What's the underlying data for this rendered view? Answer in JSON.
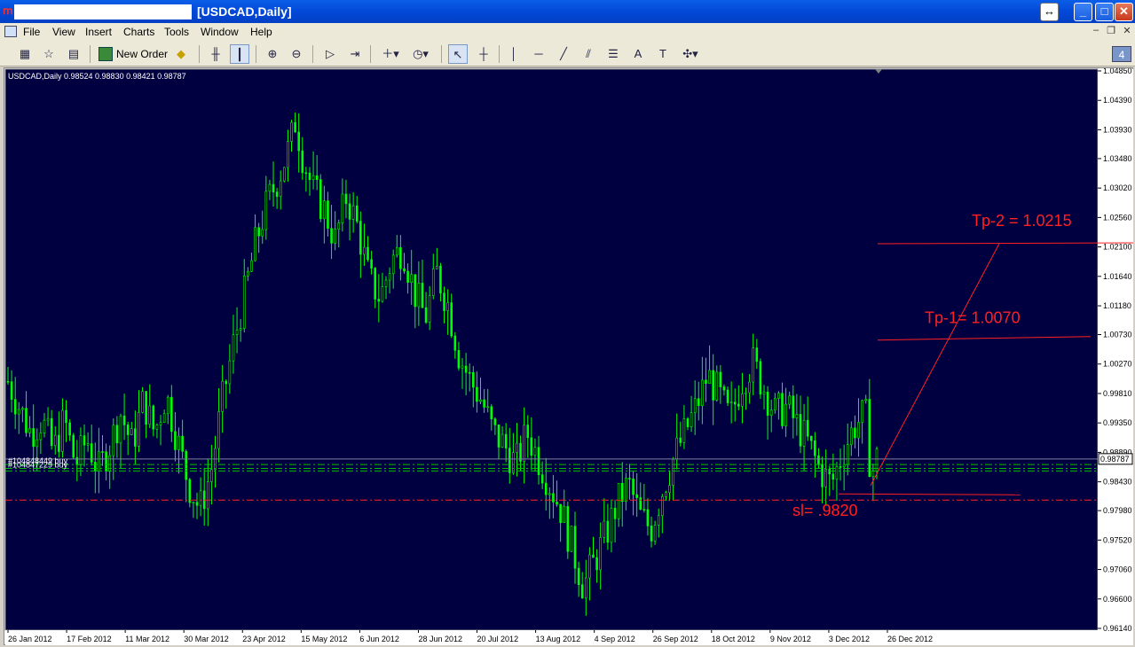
{
  "window": {
    "title": "[USDCAD,Daily]",
    "min_icon": "minimize-icon",
    "max_icon": "maximize-icon",
    "close_icon": "close-icon"
  },
  "menu": [
    "File",
    "View",
    "Insert",
    "Charts",
    "Tools",
    "Window",
    "Help"
  ],
  "toolbar": {
    "new_order": "New Order",
    "badge": "4"
  },
  "colors": {
    "chart_bg": "#000040",
    "candle": "#00ff00",
    "annotation": "#ff2020",
    "trade_line": "#00c000"
  },
  "chart_data": {
    "type": "candlestick",
    "symbol_info": "USDCAD,Daily  0.98524 0.98830 0.98421 0.98787",
    "x_ticks": [
      "26 Jan 2012",
      "17 Feb 2012",
      "11 Mar 2012",
      "30 Mar 2012",
      "23 Apr 2012",
      "15 May 2012",
      "6 Jun 2012",
      "28 Jun 2012",
      "20 Jul 2012",
      "13 Aug 2012",
      "4 Sep 2012",
      "26 Sep 2012",
      "18 Oct 2012",
      "9 Nov 2012",
      "3 Dec 2012",
      "26 Dec 2012"
    ],
    "y_ticks": [
      "1.04850",
      "1.04390",
      "1.03930",
      "1.03480",
      "1.03020",
      "1.02560",
      "1.02100",
      "1.01640",
      "1.01180",
      "1.00730",
      "1.00270",
      "0.99810",
      "0.99350",
      "0.98890",
      "0.98430",
      "0.97980",
      "0.97520",
      "0.97060",
      "0.96600",
      "0.96140"
    ],
    "ylim": [
      0.9614,
      1.0485
    ],
    "current_price": "0.98787",
    "current_value": 0.98787,
    "price_path": [
      [
        0,
        1.0
      ],
      [
        2,
        0.996
      ],
      [
        4,
        0.992
      ],
      [
        6,
        0.994
      ],
      [
        8,
        0.989
      ],
      [
        10,
        0.994
      ],
      [
        12,
        0.987
      ],
      [
        14,
        0.991
      ],
      [
        16,
        0.986
      ],
      [
        18,
        0.99
      ],
      [
        20,
        0.995
      ],
      [
        22,
        0.99
      ],
      [
        24,
        0.997
      ],
      [
        26,
        0.992
      ],
      [
        28,
        0.998
      ],
      [
        30,
        0.991
      ],
      [
        32,
        0.984
      ],
      [
        34,
        0.98
      ],
      [
        36,
        0.986
      ],
      [
        38,
        0.997
      ],
      [
        40,
        1.006
      ],
      [
        42,
        1.014
      ],
      [
        44,
        1.022
      ],
      [
        46,
        1.028
      ],
      [
        48,
        1.032
      ],
      [
        50,
        1.037
      ],
      [
        51,
        1.041
      ],
      [
        52,
        1.036
      ],
      [
        54,
        1.03
      ],
      [
        56,
        1.027
      ],
      [
        58,
        1.022
      ],
      [
        60,
        1.029
      ],
      [
        62,
        1.024
      ],
      [
        64,
        1.016
      ],
      [
        66,
        1.013
      ],
      [
        68,
        1.019
      ],
      [
        70,
        1.021
      ],
      [
        72,
        1.014
      ],
      [
        74,
        1.01
      ],
      [
        76,
        1.017
      ],
      [
        78,
        1.012
      ],
      [
        80,
        1.004
      ],
      [
        82,
        1.0
      ],
      [
        84,
        0.997
      ],
      [
        86,
        0.992
      ],
      [
        88,
        0.99
      ],
      [
        90,
        0.987
      ],
      [
        92,
        0.992
      ],
      [
        94,
        0.988
      ],
      [
        96,
        0.984
      ],
      [
        98,
        0.98
      ],
      [
        100,
        0.974
      ],
      [
        102,
        0.968
      ],
      [
        104,
        0.972
      ],
      [
        106,
        0.976
      ],
      [
        108,
        0.981
      ],
      [
        110,
        0.984
      ],
      [
        112,
        0.979
      ],
      [
        114,
        0.977
      ],
      [
        116,
        0.983
      ],
      [
        118,
        0.988
      ],
      [
        120,
        0.992
      ],
      [
        122,
        0.996
      ],
      [
        124,
        1.001
      ],
      [
        126,
        0.998
      ],
      [
        128,
        0.994
      ],
      [
        130,
        1.0
      ],
      [
        132,
        1.003
      ],
      [
        134,
        0.999
      ],
      [
        136,
        0.995
      ],
      [
        138,
        0.996
      ],
      [
        140,
        0.993
      ],
      [
        142,
        0.99
      ],
      [
        144,
        0.986
      ],
      [
        146,
        0.984
      ],
      [
        148,
        0.989
      ],
      [
        150,
        0.993
      ],
      [
        152,
        0.995
      ],
      [
        153,
        0.9852
      ],
      [
        154,
        0.9879
      ]
    ],
    "trade_lines": [
      {
        "label": "#104848449 buy",
        "value": 0.987
      },
      {
        "label": "#104847229 buy",
        "value": 0.9864
      },
      {
        "label": "",
        "value": 0.986
      }
    ],
    "annotations": [
      {
        "text": "Tp-2 = 1.0215",
        "value": 1.0215
      },
      {
        "text": "Tp-1= 1.0070",
        "value": 1.007
      },
      {
        "text": "sl= .9820",
        "value": 0.982
      }
    ]
  }
}
